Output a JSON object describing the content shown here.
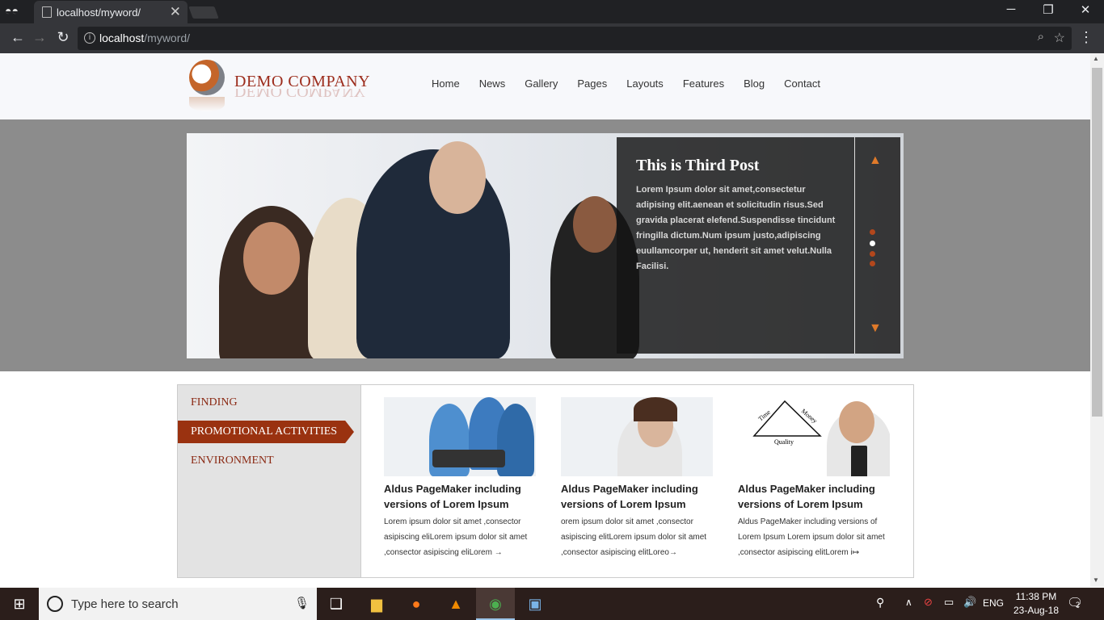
{
  "browser": {
    "tab_title": "localhost/myword/",
    "tab_close": "✕",
    "url_host": "localhost",
    "url_path": "/myword/",
    "window_controls": [
      "minimize-icon",
      "restore-icon",
      "close-icon"
    ]
  },
  "site": {
    "logo_text": "DEMO COMPANY",
    "nav": [
      "Home",
      "News",
      "Gallery",
      "Pages",
      "Layouts",
      "Features",
      "Blog",
      "Contact"
    ]
  },
  "slider": {
    "title": "This is Third Post",
    "text": "Lorem Ipsum dolor sit amet,consectetur adipising elit.aenean et solicitudin risus.Sed gravida placerat elefend.Suspendisse tincidunt fringilla dictum.Num ipsum justo,adipiscing euullamcorper ut, henderit sit amet velut.Nulla Facilisi.",
    "dots": 4,
    "active_dot": 1
  },
  "tabs": {
    "items": [
      "FINDING",
      "PROMOTIONAL ACTIVITIES",
      "ENVIRONMENT"
    ],
    "active_index": 1
  },
  "cards": [
    {
      "title": "Aldus PageMaker including versions of Lorem Ipsum",
      "text": "Lorem ipsum dolor sit amet ,consector asipiscing eliLorem ipsum dolor sit amet ,consector asipiscing eliLorem →"
    },
    {
      "title": "Aldus PageMaker including versions of Lorem Ipsum",
      "text": "orem ipsum dolor sit amet ,consector asipiscing elitLorem ipsum dolor sit amet ,consector asipiscing elitLoreo→"
    },
    {
      "title": "Aldus PageMaker including versions of Lorem Ipsum",
      "text": "Aldus PageMaker including versions of Lorem Ipsum Lorem ipsum dolor sit amet ,consector asipiscing elitLorem i↦"
    }
  ],
  "card3_diagram": [
    "Time",
    "Money",
    "Quality"
  ],
  "taskbar": {
    "search_placeholder": "Type here to search",
    "language": "ENG",
    "time": "11:38 PM",
    "date": "23-Aug-18",
    "notification_count": "2"
  }
}
